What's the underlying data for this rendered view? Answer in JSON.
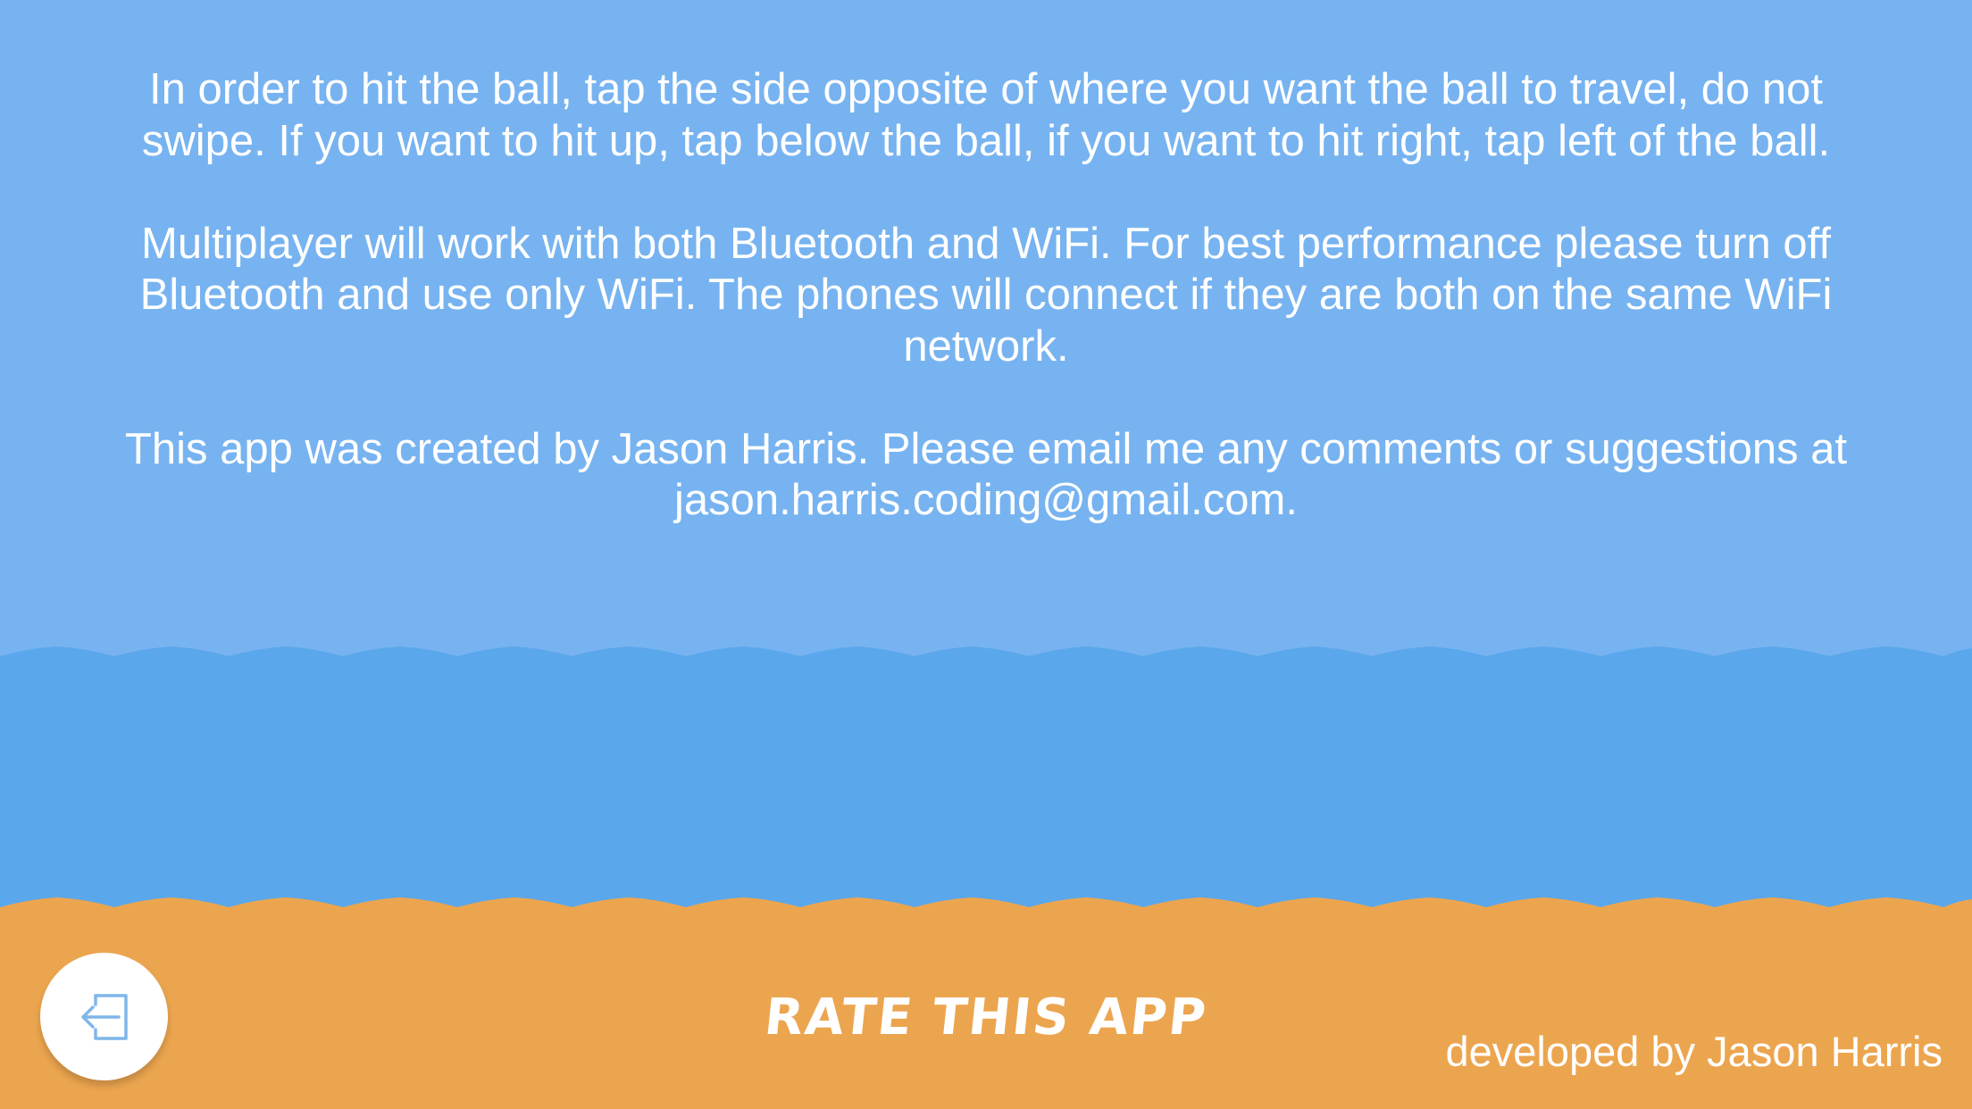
{
  "colors": {
    "sky": "#77b3f0",
    "sea": "#5aa7eb",
    "sand": "#eca54f",
    "text": "#ffffff",
    "icon": "#7fb6ea"
  },
  "info": {
    "paragraph_1": "In order to hit the ball, tap the side opposite of where you want the ball to travel, do not swipe. If you want to hit up, tap below the ball, if you want to hit right, tap left of the ball.",
    "paragraph_2": "Multiplayer will work with both Bluetooth and WiFi. For best performance please turn off Bluetooth and use only WiFi. The phones will connect if they are both on the same WiFi network.",
    "paragraph_3": "This app was created by Jason Harris.  Please email me any comments or suggestions at jason.harris.coding@gmail.com."
  },
  "footer": {
    "back_icon": "exit-arrow-icon",
    "rate_label": "RATE THIS APP",
    "developer_credit": "developed by Jason Harris"
  }
}
